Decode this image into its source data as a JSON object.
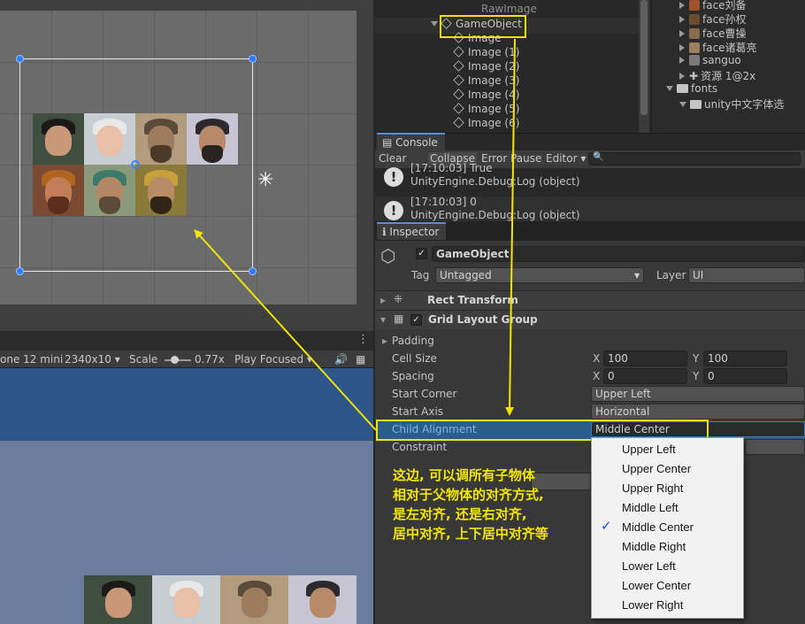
{
  "hierarchy": {
    "items": [
      {
        "label": "RawImage"
      },
      {
        "label": "GameObject"
      },
      {
        "label": "Image"
      },
      {
        "label": "Image (1)"
      },
      {
        "label": "Image (2)"
      },
      {
        "label": "Image (3)"
      },
      {
        "label": "Image (4)"
      },
      {
        "label": "Image (5)"
      },
      {
        "label": "Image (6)"
      }
    ]
  },
  "project": {
    "items": [
      {
        "label": "face刘备"
      },
      {
        "label": "face孙权"
      },
      {
        "label": "face曹操"
      },
      {
        "label": "face诸葛亮"
      },
      {
        "label": "sanguo"
      },
      {
        "label": "资源 1@2x"
      },
      {
        "label": "fonts"
      },
      {
        "label": "unity中文字体选"
      }
    ]
  },
  "console": {
    "tab": "Console",
    "toolbar": {
      "clear": "Clear",
      "collapse": "Collapse",
      "error_pause": "Error Pause",
      "editor": "Editor"
    },
    "logs": [
      {
        "line1": "[17:10:03] True",
        "line2": "UnityEngine.Debug:Log (object)"
      },
      {
        "line1": "[17:10:03] 0",
        "line2": "UnityEngine.Debug:Log (object)"
      }
    ]
  },
  "game_toolbar": {
    "device": "one 12 mini",
    "resolution": "2340x10",
    "scale_label": "Scale",
    "scale_value": "0.77x",
    "play_mode": "Play Focused"
  },
  "inspector": {
    "tab": "Inspector",
    "object_name": "GameObject",
    "tag_label": "Tag",
    "tag_value": "Untagged",
    "layer_label": "Layer",
    "layer_value": "UI",
    "rect_transform": "Rect Transform",
    "grid_layout": "Grid Layout Group",
    "padding": "Padding",
    "cell_size": {
      "label": "Cell Size",
      "x_label": "X",
      "x": "100",
      "y_label": "Y",
      "y": "100"
    },
    "spacing": {
      "label": "Spacing",
      "x_label": "X",
      "x": "0",
      "y_label": "Y",
      "y": "0"
    },
    "start_corner": {
      "label": "Start Corner",
      "value": "Upper Left"
    },
    "start_axis": {
      "label": "Start Axis",
      "value": "Horizontal"
    },
    "child_alignment": {
      "label": "Child Alignment",
      "value": "Middle Center"
    },
    "constraint": {
      "label": "Constraint"
    }
  },
  "dropdown": {
    "options": [
      "Upper Left",
      "Upper Center",
      "Upper Right",
      "Middle Left",
      "Middle Center",
      "Middle Right",
      "Lower Left",
      "Lower Center",
      "Lower Right"
    ],
    "selected": "Middle Center",
    "check_glyph": "✓"
  },
  "annotation": {
    "lines": [
      "这边, 可以调所有子物体",
      "相对于父物体的对齐方式,",
      "是左对齐, 还是右对齐,",
      "居中对齐, 上下居中对齐等"
    ],
    "color": "#f2e600"
  },
  "colors": {
    "accent": "#2f7bff",
    "highlight": "#f2e600",
    "selected_row": "#2c5d87"
  }
}
